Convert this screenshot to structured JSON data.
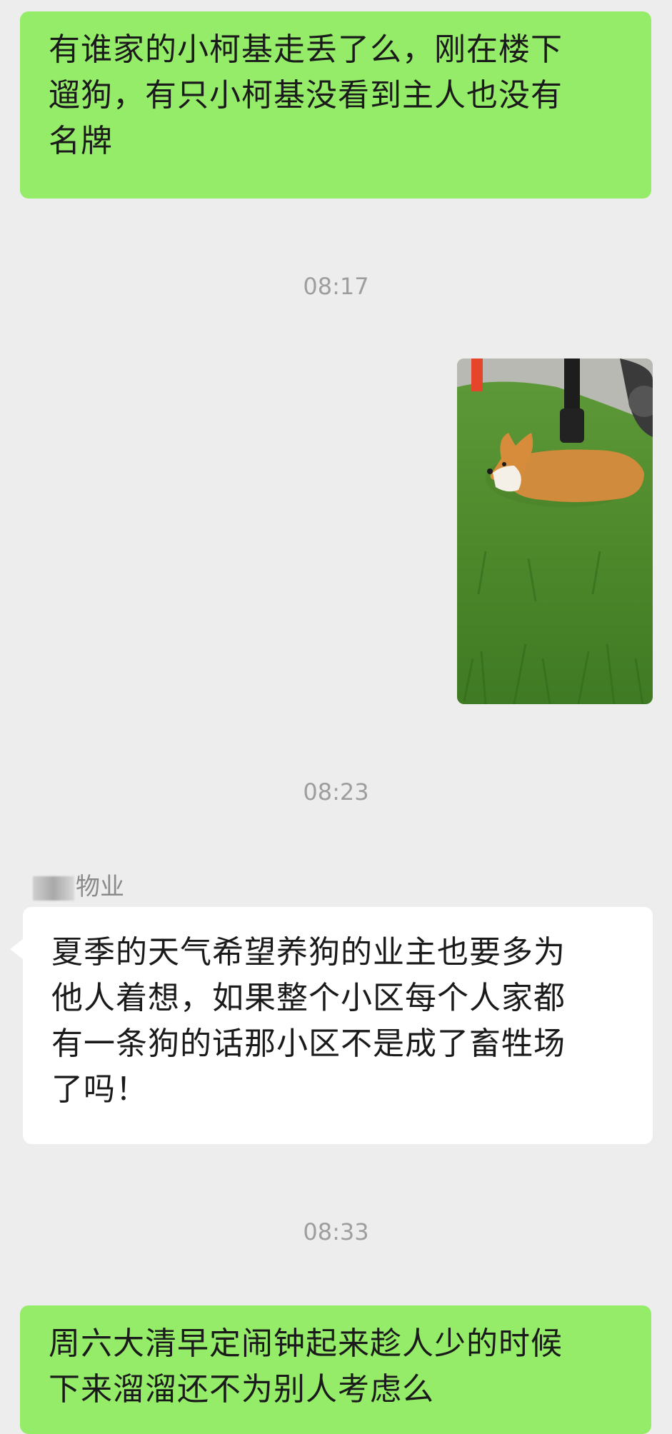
{
  "messages": [
    {
      "kind": "sent",
      "lines": [
        "有谁家的小柯基走丢了么，刚在楼下",
        "遛狗，有只小柯基没看到主人也没有",
        "名牌"
      ]
    },
    {
      "kind": "time",
      "text": "08:17"
    },
    {
      "kind": "image",
      "description_icon": "photo-icon"
    },
    {
      "kind": "time",
      "text": "08:23"
    },
    {
      "kind": "received",
      "sender_suffix": "物业",
      "lines": [
        "夏季的天气希望养狗的业主也要多为",
        "他人着想，如果整个小区每个人家都",
        "有一条狗的话那小区不是成了畜牲场",
        "了吗！"
      ]
    },
    {
      "kind": "time",
      "text": "08:33"
    },
    {
      "kind": "sent",
      "lines": [
        "周六大清早定闹钟起来趁人少的时候",
        "下来溜溜还不为别人考虑么"
      ]
    }
  ],
  "colors": {
    "background": "#ededed",
    "sent_bubble": "#95ec69",
    "received_bubble": "#ffffff",
    "timestamp": "#9e9e9e"
  }
}
